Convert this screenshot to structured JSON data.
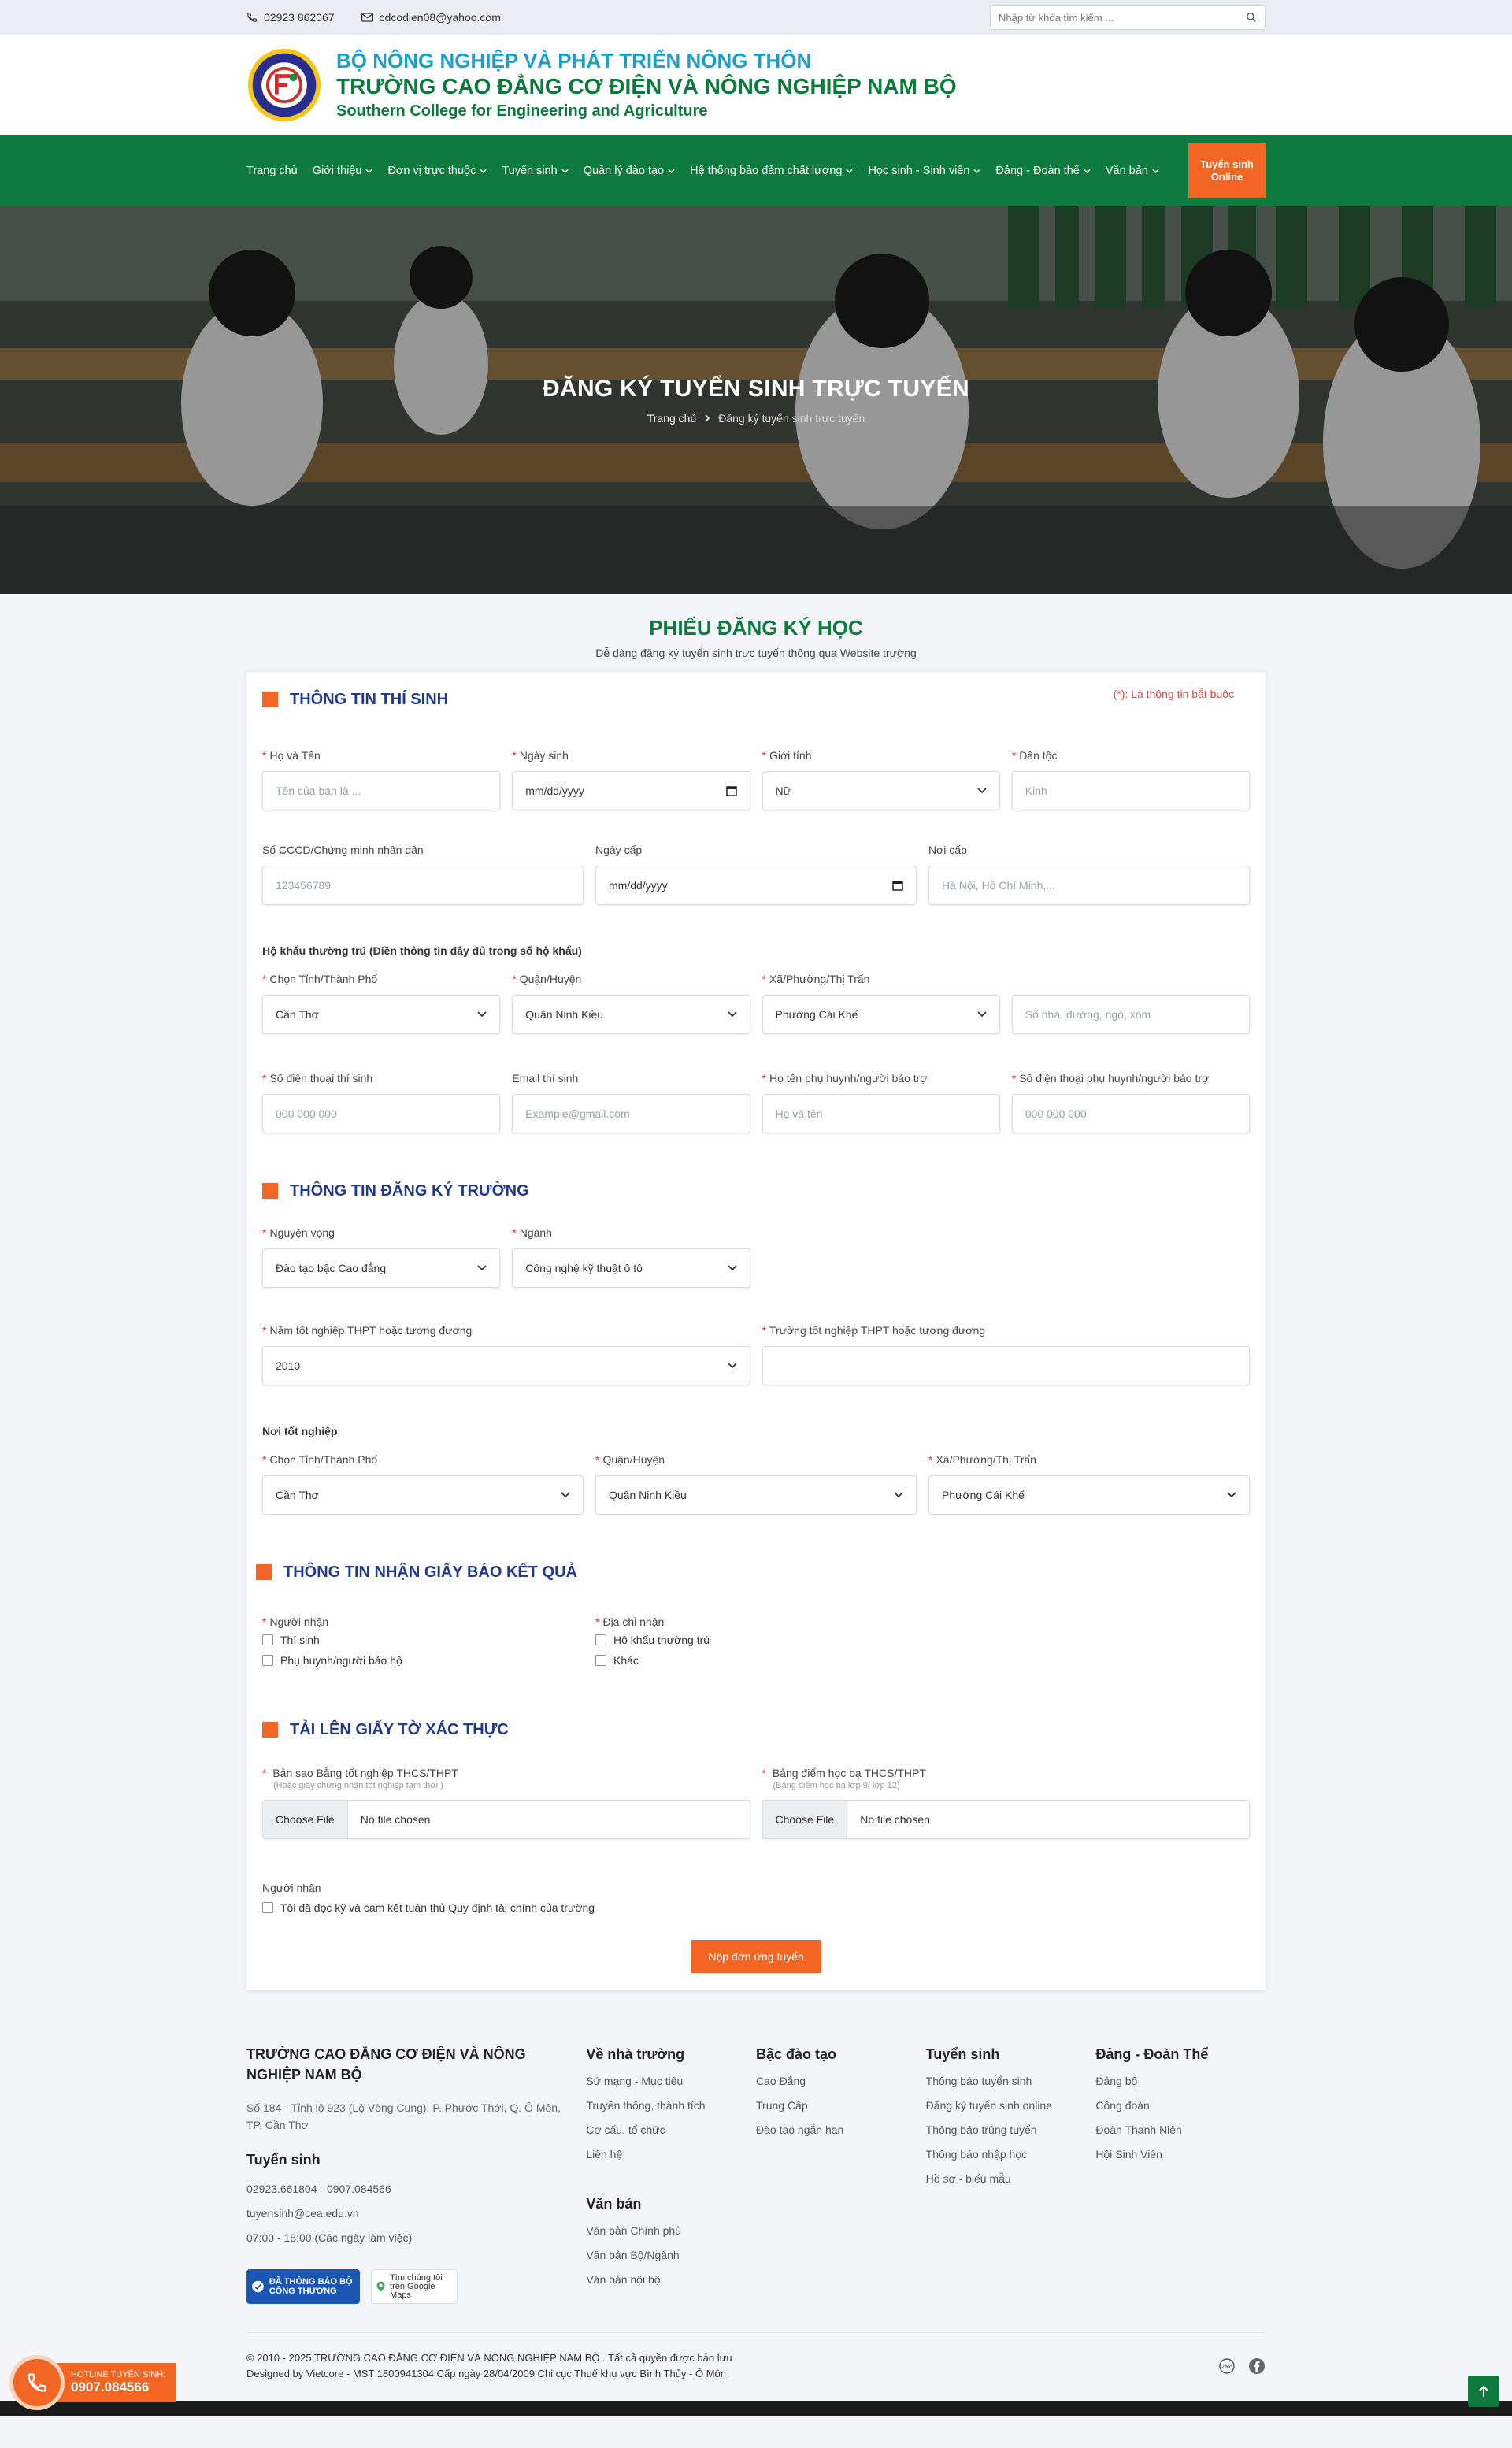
{
  "topbar": {
    "phone": "02923 862067",
    "email": "cdcodien08@yahoo.com",
    "search_placeholder": "Nhập từ khóa tìm kiếm ..."
  },
  "header": {
    "line1": "BỘ NÔNG NGHIỆP VÀ PHÁT TRIỂN NÔNG THÔN",
    "line2": "TRƯỜNG CAO ĐẲNG CƠ ĐIỆN VÀ NÔNG NGHIỆP NAM BỘ",
    "line3": "Southern College for Engineering and Agriculture"
  },
  "nav": {
    "items": [
      {
        "label": "Trang chủ",
        "dropdown": false
      },
      {
        "label": "Giới thiệu",
        "dropdown": true
      },
      {
        "label": "Đơn vị trực thuộc",
        "dropdown": true
      },
      {
        "label": "Tuyển sinh",
        "dropdown": true
      },
      {
        "label": "Quản lý đào tạo",
        "dropdown": true
      },
      {
        "label": "Hệ thống bảo đảm chất lượng",
        "dropdown": true
      },
      {
        "label": "Học sinh - Sinh viên",
        "dropdown": true
      },
      {
        "label": "Đảng - Đoàn thể",
        "dropdown": true
      },
      {
        "label": "Văn bản",
        "dropdown": true
      }
    ],
    "cta": "Tuyển sinh Online"
  },
  "hero": {
    "title": "ĐĂNG KÝ TUYỂN SINH TRỰC TUYẾN",
    "crumb_home": "Trang chủ",
    "crumb_current": "Đăng ký tuyển sinh trực tuyến"
  },
  "form": {
    "title": "PHIẾU ĐĂNG KÝ HỌC",
    "subtitle": "Dễ dàng đăng ký tuyển sinh trực tuyến thông qua Website trường",
    "required_note": "(*): Là thông tin bắt buộc",
    "s1": {
      "title": "THÔNG TIN THÍ SINH",
      "name_label": "Họ và Tên",
      "name_ph": "Tên của bạn là ...",
      "dob_label": "Ngày sinh",
      "dob_value": "mm/dd/yyyy",
      "gender_label": "Giới tính",
      "gender_value": "Nữ",
      "ethnic_label": "Dân tộc",
      "ethnic_ph": "Kinh",
      "id_label": "Số CCCD/Chứng minh nhân dân",
      "id_ph": "123456789",
      "issue_label": "Ngày cấp",
      "issue_value": "mm/dd/yyyy",
      "place_label": "Nơi cấp",
      "place_ph": "Hà Nội, Hồ Chí Minh,...",
      "addr_title": "Hộ khẩu thường trú (Điền thông tin đầy đủ trong sổ hộ khẩu)",
      "prov_label": "Chọn Tỉnh/Thành Phố",
      "prov_value": "Cần Thơ",
      "dist_label": "Quận/Huyện",
      "dist_value": "Quận Ninh Kiều",
      "ward_label": "Xã/Phường/Thị Trấn",
      "ward_value": "Phường Cái Khế",
      "street_ph": "Số nhà, đường, ngõ, xóm",
      "phone_label": "Số điện thoại thí sinh",
      "phone_ph": "000 000 000",
      "mail_label": "Email thí sinh",
      "mail_ph": "Example@gmail.com",
      "parent_label": "Họ tên phụ huynh/người bảo trợ",
      "parent_ph": "Họ và tên",
      "pphone_label": "Số điện thoại phụ huynh/người bảo trợ",
      "pphone_ph": "000 000 000"
    },
    "s2": {
      "title": "THÔNG TIN ĐĂNG KÝ TRƯỜNG",
      "wish_label": "Nguyện vọng",
      "wish_value": "Đào tạo bậc Cao đẳng",
      "major_label": "Ngành",
      "major_value": "Công nghệ kỹ thuật ô tô",
      "year_label": "Năm tốt nghiệp THPT hoặc tương đương",
      "year_value": "2010",
      "school_label": "Trường tốt nghiệp THPT hoặc tương đương",
      "school_ph": "",
      "grad_title": "Nơi tốt nghiệp",
      "prov_label": "Chọn Tỉnh/Thành Phố",
      "prov_value": "Cần Thơ",
      "dist_label": "Quận/Huyện",
      "dist_value": "Quận Ninh Kiều",
      "ward_label": "Xã/Phường/Thị Trấn",
      "ward_value": "Phường Cái Khế"
    },
    "s3": {
      "title": "THÔNG TIN NHẬN GIẤY BÁO KẾT QUẢ",
      "recv_label": "Người nhận",
      "recv_opt1": "Thí sinh",
      "recv_opt2": "Phụ huynh/người bảo hộ",
      "addr_label": "Địa chỉ nhận",
      "addr_opt1": "Hộ khẩu thường trú",
      "addr_opt2": "Khác"
    },
    "s4": {
      "title": "TẢI LÊN GIẤY TỜ XÁC THỰC",
      "f1_label": "Bản sao Bằng tốt nghiệp THCS/THPT",
      "f1_hint": "(Hoặc giấy chứng nhận tốt nghiệp tạm thời )",
      "f2_label": "Bảng điểm học bạ THCS/THPT",
      "f2_hint": "(Bảng điểm học bạ lớp 9/ lớp 12)",
      "choose": "Choose File",
      "nofile": "No file chosen",
      "agree_title": "Người nhận",
      "agree_text": "Tôi đã đọc kỹ và cam kết tuân thủ Quy định tài chính của trường",
      "submit": "Nộp đơn ứng tuyển"
    }
  },
  "footer": {
    "school": "TRƯỜNG CAO ĐẲNG CƠ ĐIỆN VÀ NÔNG NGHIỆP NAM BỘ",
    "address": "Số 184 - Tỉnh lộ 923 (Lộ Vòng Cung), P. Phước Thới, Q. Ô Môn, TP. Cần Thơ",
    "ts_title": "Tuyển sinh",
    "ts_phone": "02923.661804  -  0907.084566",
    "ts_mail": "tuyensinh@cea.edu.vn",
    "ts_hours": "07:00 - 18:00 (Các ngày làm việc)",
    "badge1": "ĐÃ THÔNG BÁO BỘ CÔNG THƯƠNG",
    "badge2": "Tìm chúng tôi trên Google Maps",
    "col2_title": "Về nhà trường",
    "col2": [
      "Sứ mạng - Mục tiêu",
      "Truyền thống, thành tích",
      "Cơ cấu, tổ chức",
      "Liên hệ"
    ],
    "col2b_title": "Văn bản",
    "col2b": [
      "Văn bản Chính phủ",
      "Văn bản Bộ/Ngành",
      "Văn bản nội bộ"
    ],
    "col3_title": "Bậc đào tạo",
    "col3": [
      "Cao Đẳng",
      "Trung Cấp",
      "Đào tạo ngắn hạn"
    ],
    "col4_title": "Tuyển sinh",
    "col4": [
      "Thông báo tuyển sinh",
      "Đăng ký tuyển sinh online",
      "Thông báo trúng tuyển",
      "Thông báo nhập học",
      "Hồ sơ - biểu mẫu"
    ],
    "col5_title": "Đảng - Đoàn Thể",
    "col5": [
      "Đảng bộ",
      "Công đoàn",
      "Đoàn Thanh Niên",
      "Hội Sinh Viên"
    ],
    "copy1": "© 2010 - 2025 TRƯỜNG CAO ĐẲNG CƠ ĐIỆN VÀ NÔNG NGHIỆP NAM BỘ . Tất cả quyền được bảo lưu",
    "copy2": "Designed by Vietcore - MST 1800941304 Cấp ngày 28/04/2009 Chi cục Thuế khu vực Bình Thủy - Ô Môn",
    "zalo": "Zalo"
  },
  "hotline": {
    "label": "HOTLINE TUYỂN SINH:",
    "number": "0907.084566"
  },
  "colors": {
    "green": "#0e7a3d",
    "orange": "#f26522",
    "navy": "#1f3a8a",
    "cyan": "#1aa0c6"
  }
}
